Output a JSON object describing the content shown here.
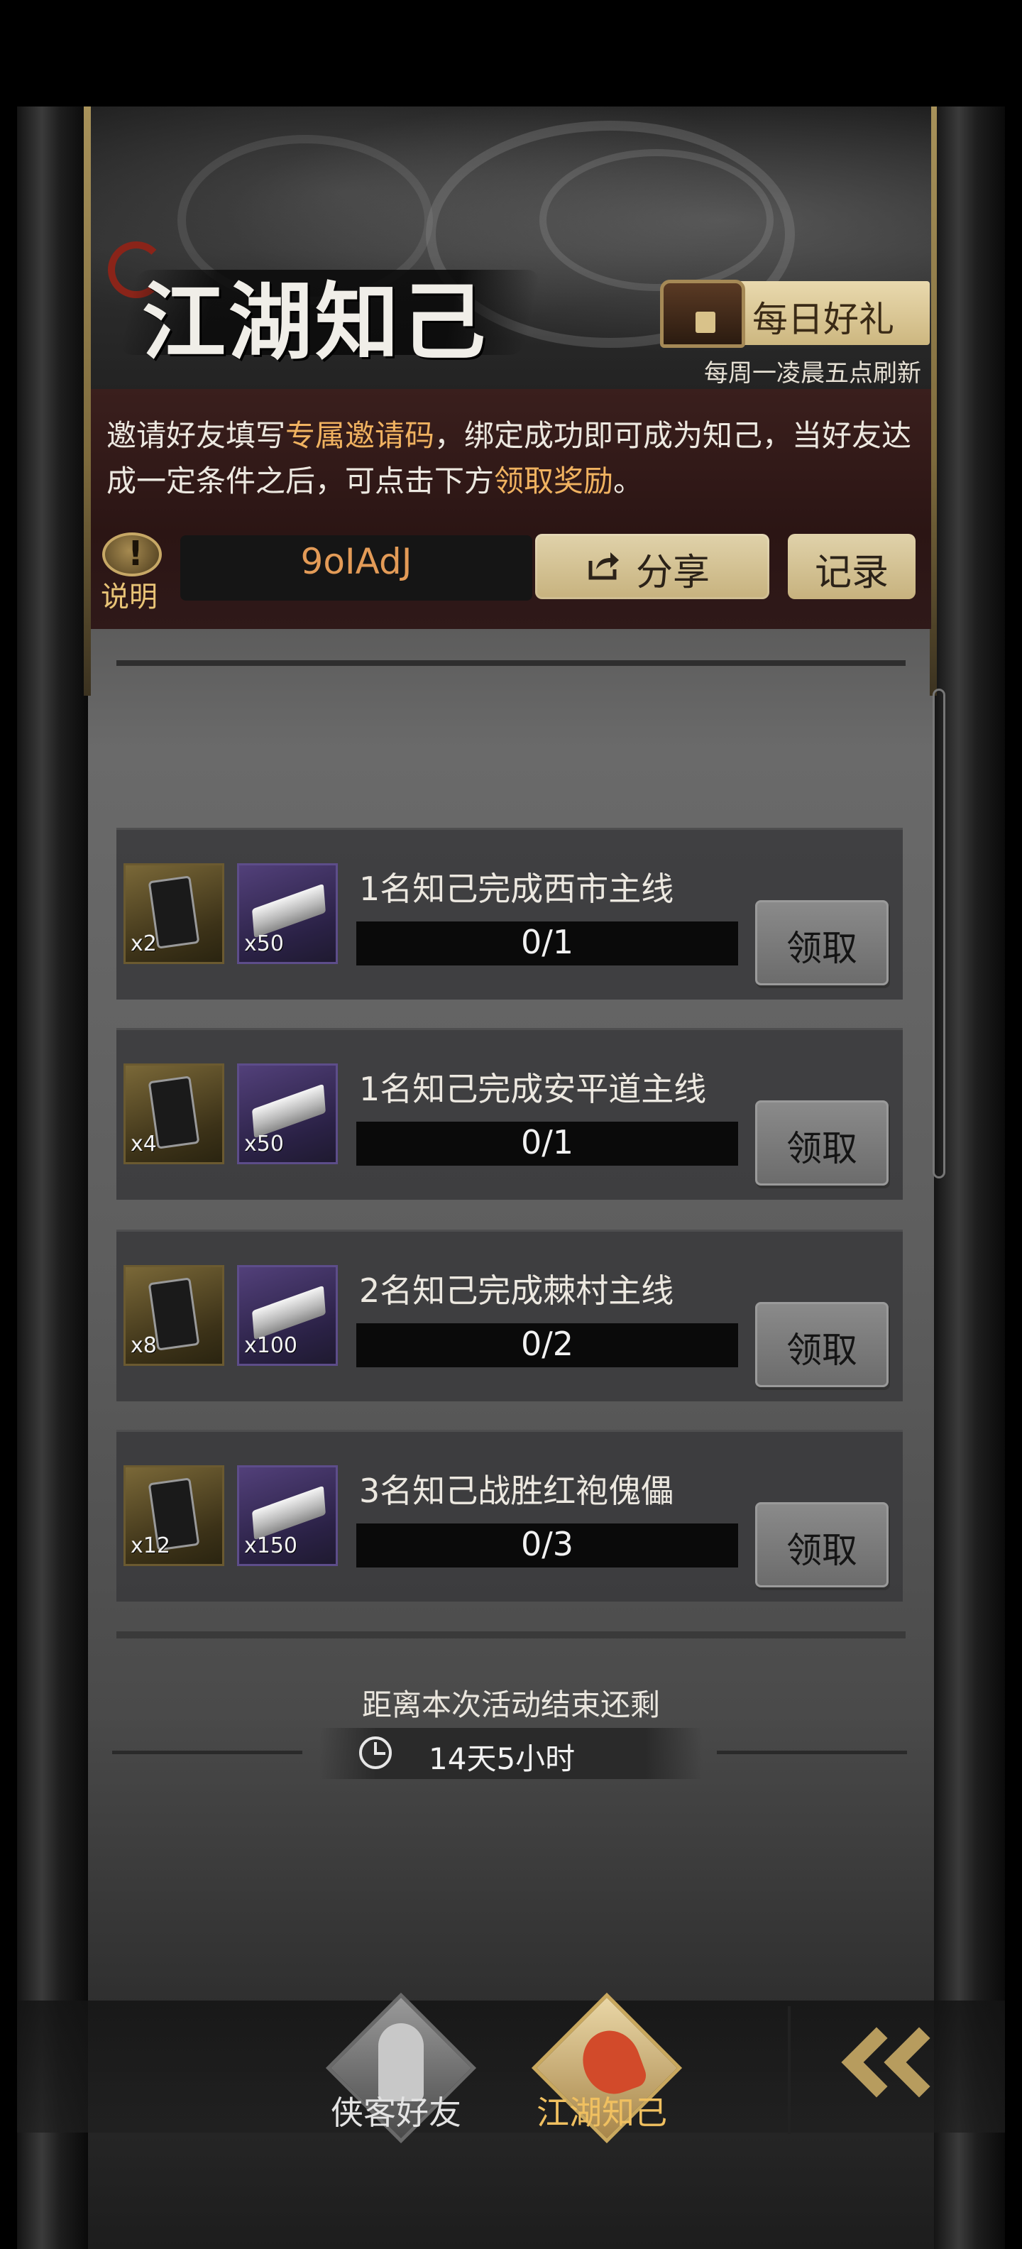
{
  "header": {
    "title": "江湖知己",
    "daily_gift_label": "每日好礼",
    "refresh_note": "每周一凌晨五点刷新"
  },
  "invite": {
    "desc_part1": "邀请好友填写",
    "desc_highlight1": "专属邀请码",
    "desc_part2": "，绑定成功即可成为知己，当好友达成一定条件之后，可点击下方",
    "desc_highlight2": "领取奖励",
    "desc_part3": "。",
    "info_label": "说明",
    "code": "9oIAdJ",
    "share_label": "分享",
    "record_label": "记录",
    "colors": {
      "highlight": "#f0b260",
      "code": "#e39b57"
    }
  },
  "tasks": [
    {
      "title": "1名知己完成西市主线",
      "progress": "0/1",
      "reward_book_qty": "x2",
      "reward_silver_qty": "x50",
      "claim_label": "领取"
    },
    {
      "title": "1名知己完成安平道主线",
      "progress": "0/1",
      "reward_book_qty": "x4",
      "reward_silver_qty": "x50",
      "claim_label": "领取"
    },
    {
      "title": "2名知己完成棘村主线",
      "progress": "0/2",
      "reward_book_qty": "x8",
      "reward_silver_qty": "x100",
      "claim_label": "领取"
    },
    {
      "title": "3名知己战胜红袍傀儡",
      "progress": "0/3",
      "reward_book_qty": "x12",
      "reward_silver_qty": "x150",
      "claim_label": "领取"
    }
  ],
  "timer": {
    "caption": "距离本次活动结束还剩",
    "value": "14天5小时"
  },
  "bottom_nav": {
    "tabs": [
      {
        "label": "侠客好友",
        "active": false
      },
      {
        "label": "江湖知己",
        "active": true
      }
    ],
    "back_icon": "double-chevron-left-icon"
  }
}
